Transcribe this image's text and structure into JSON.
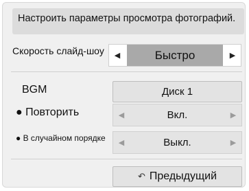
{
  "header": {
    "title": "Настроить параметры просмотра фотографий."
  },
  "slideshow_speed": {
    "label": "Скорость слайд-шоу",
    "value": "Быстро",
    "left_arrow": "◀",
    "right_arrow": "▶"
  },
  "bgm": {
    "label": "BGM",
    "button_label": "Диск 1"
  },
  "repeat": {
    "label": "● Повторить",
    "value": "Вкл.",
    "left_arrow": "◀",
    "right_arrow": "▶"
  },
  "shuffle": {
    "label": "● В случайном порядке",
    "value": "Выкл.",
    "left_arrow": "◀",
    "right_arrow": "▶"
  },
  "footer": {
    "previous_label": "Предыдущий",
    "previous_icon": "return-arrow-icon"
  },
  "colors": {
    "panel_bg": "#f0f0f0",
    "header_bg": "#dcdcdc",
    "selected_value_bg": "#a9a9a9",
    "disabled_arrow": "#9b9b9b"
  }
}
